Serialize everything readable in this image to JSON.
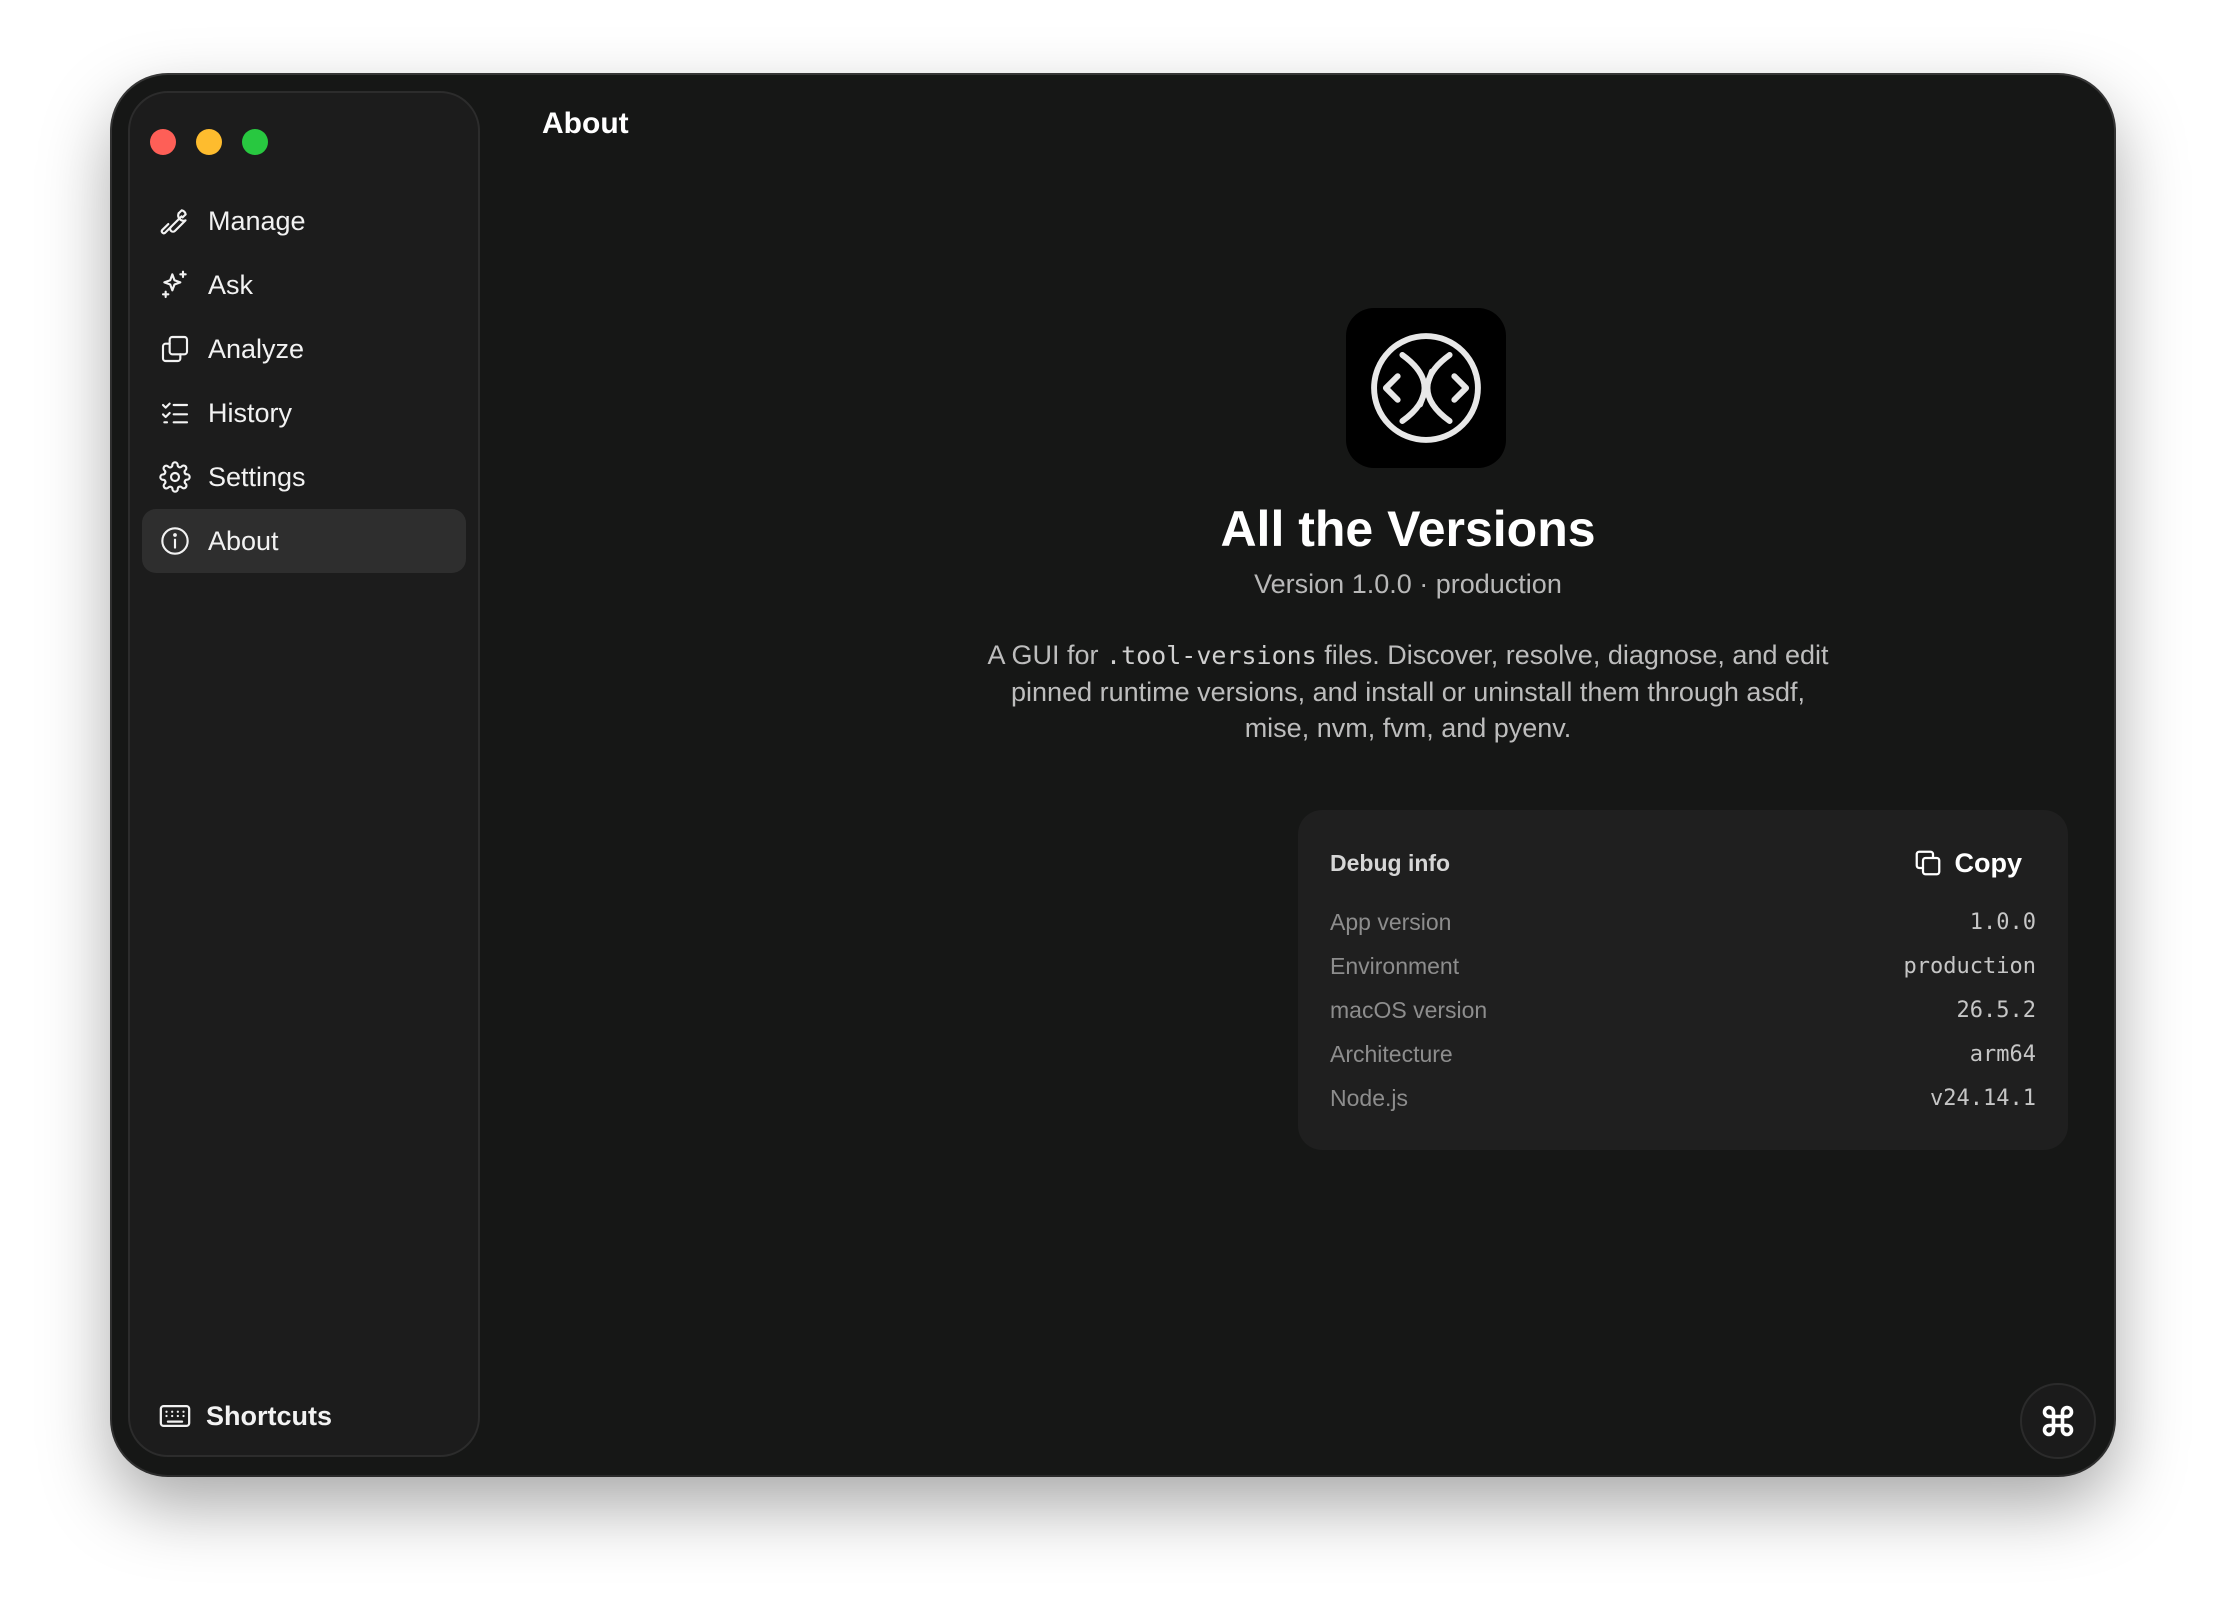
{
  "window": {
    "traffic_lights": [
      "close",
      "minimize",
      "zoom"
    ]
  },
  "sidebar": {
    "items": [
      {
        "label": "Manage",
        "icon": "wrench-icon"
      },
      {
        "label": "Ask",
        "icon": "sparkles-icon"
      },
      {
        "label": "Analyze",
        "icon": "layers-icon"
      },
      {
        "label": "History",
        "icon": "list-check-icon"
      },
      {
        "label": "Settings",
        "icon": "gear-icon"
      },
      {
        "label": "About",
        "icon": "info-icon",
        "active": true
      }
    ],
    "footer": {
      "label": "Shortcuts",
      "icon": "keyboard-icon"
    }
  },
  "header": {
    "title": "About"
  },
  "about": {
    "app_name": "All the Versions",
    "version_line": "Version 1.0.0 · production",
    "description_pre": "A GUI for ",
    "description_code": ".tool-versions",
    "description_post": " files. Discover, resolve, diagnose, and edit pinned runtime versions, and install or uninstall them through asdf, mise, nvm, fvm, and pyenv."
  },
  "debug": {
    "title": "Debug info",
    "copy_label": "Copy",
    "rows": [
      {
        "label": "App version",
        "value": "1.0.0"
      },
      {
        "label": "Environment",
        "value": "production"
      },
      {
        "label": "macOS version",
        "value": "26.5.2"
      },
      {
        "label": "Architecture",
        "value": "arm64"
      },
      {
        "label": "Node.js",
        "value": "v24.14.1"
      }
    ]
  },
  "colors": {
    "background": "#161716",
    "sidebar": "#1c1c1c",
    "active_item": "#2e2e2e",
    "card": "#1f1f1f"
  }
}
